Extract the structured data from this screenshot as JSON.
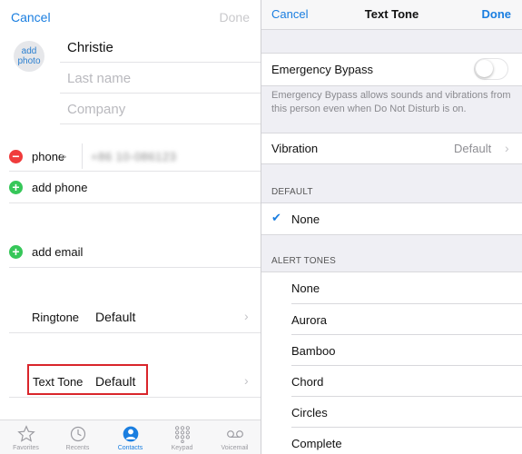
{
  "left": {
    "nav": {
      "cancel": "Cancel",
      "done": "Done"
    },
    "add_photo": "add photo",
    "first_name": "Christie",
    "last_name_placeholder": "Last name",
    "company_placeholder": "Company",
    "phone_label": "phone",
    "phone_chevron": ">",
    "phone_value": "+86 10-086123",
    "add_phone": "add phone",
    "add_email": "add email",
    "ringtone": {
      "label": "Ringtone",
      "value": "Default"
    },
    "text_tone": {
      "label": "Text Tone",
      "value": "Default"
    },
    "chevron": "›",
    "colors": {
      "accent": "#1a7ee0",
      "delete": "#f03b3b",
      "add": "#36c759",
      "highlight": "#d9252b"
    }
  },
  "tabbar": {
    "tabs": [
      {
        "label": "Favorites",
        "icon": "star-icon"
      },
      {
        "label": "Recents",
        "icon": "clock-icon"
      },
      {
        "label": "Contacts",
        "icon": "person-icon",
        "active": true
      },
      {
        "label": "Keypad",
        "icon": "keypad-icon"
      },
      {
        "label": "Voicemail",
        "icon": "voicemail-icon"
      }
    ]
  },
  "right": {
    "nav": {
      "cancel": "Cancel",
      "title": "Text Tone",
      "done": "Done"
    },
    "emergency_bypass": {
      "label": "Emergency Bypass",
      "enabled": false
    },
    "emergency_footer": "Emergency Bypass allows sounds and vibrations from this person even when Do Not Disturb is on.",
    "vibration": {
      "label": "Vibration",
      "value": "Default",
      "chevron": "›"
    },
    "default_header": "DEFAULT",
    "default_selected": "None",
    "alert_header": "ALERT TONES",
    "alert_tones": [
      "None",
      "Aurora",
      "Bamboo",
      "Chord",
      "Circles",
      "Complete"
    ]
  }
}
